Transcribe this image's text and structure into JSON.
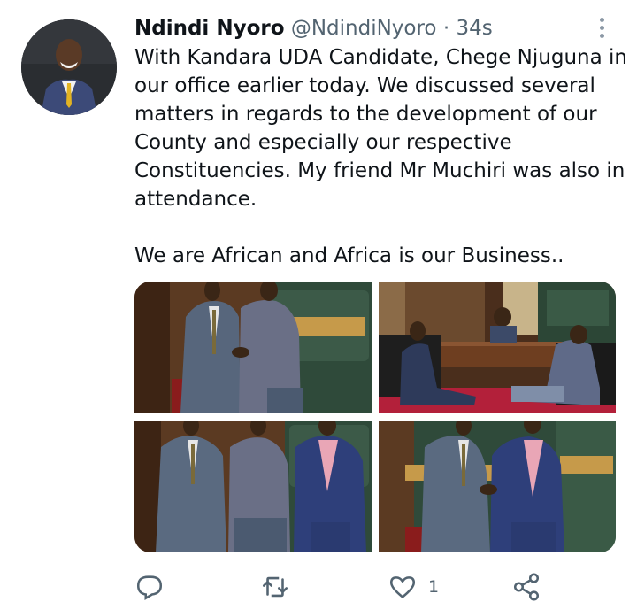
{
  "tweet": {
    "author_name": "Ndindi Nyoro",
    "author_handle": "@NdindiNyoro",
    "separator": "·",
    "time": "34s",
    "text": "With Kandara UDA Candidate, Chege Njuguna in our office earlier today. We discussed several matters in regards to the development of our County and especially our respective Constituencies. My friend Mr Muchiri was also in attendance.\n\nWe are African and Africa is our Business..",
    "like_count": "1"
  },
  "icons": {
    "more": "more-vertical-icon",
    "reply": "reply-icon",
    "retweet": "retweet-icon",
    "like": "heart-icon",
    "share": "share-icon"
  },
  "colors": {
    "text": "#0f1419",
    "secondary": "#536471",
    "background": "#ffffff"
  }
}
